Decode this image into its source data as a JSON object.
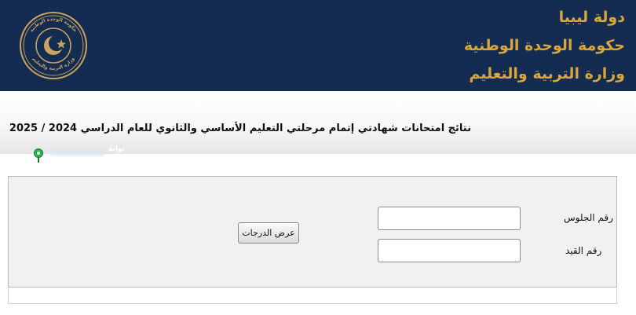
{
  "header": {
    "lines": [
      "دولة ليبيا",
      "حكومة الوحدة الوطنية",
      "وزارة التربية والتعليم"
    ],
    "emblem_text_top": "حكومة الوحدة الوطنية",
    "emblem_text_bottom": "وزارة التربية والتعليم",
    "colors": {
      "background": "#142b52",
      "accent": "#d9a63a"
    }
  },
  "page_title": "نتائج امتحانات شهادتي إتمام مرحلتي التعليم الأساسي والثانوي للعام الدراسي 2024 / 2025",
  "portal": {
    "label": "بوابة",
    "icon": "map-pin-icon"
  },
  "form": {
    "seat_label": "رقم الجلوس",
    "seat_value": "",
    "registration_label": "رقم القيد",
    "registration_value": "",
    "submit_label": "عرض الدرجات"
  }
}
